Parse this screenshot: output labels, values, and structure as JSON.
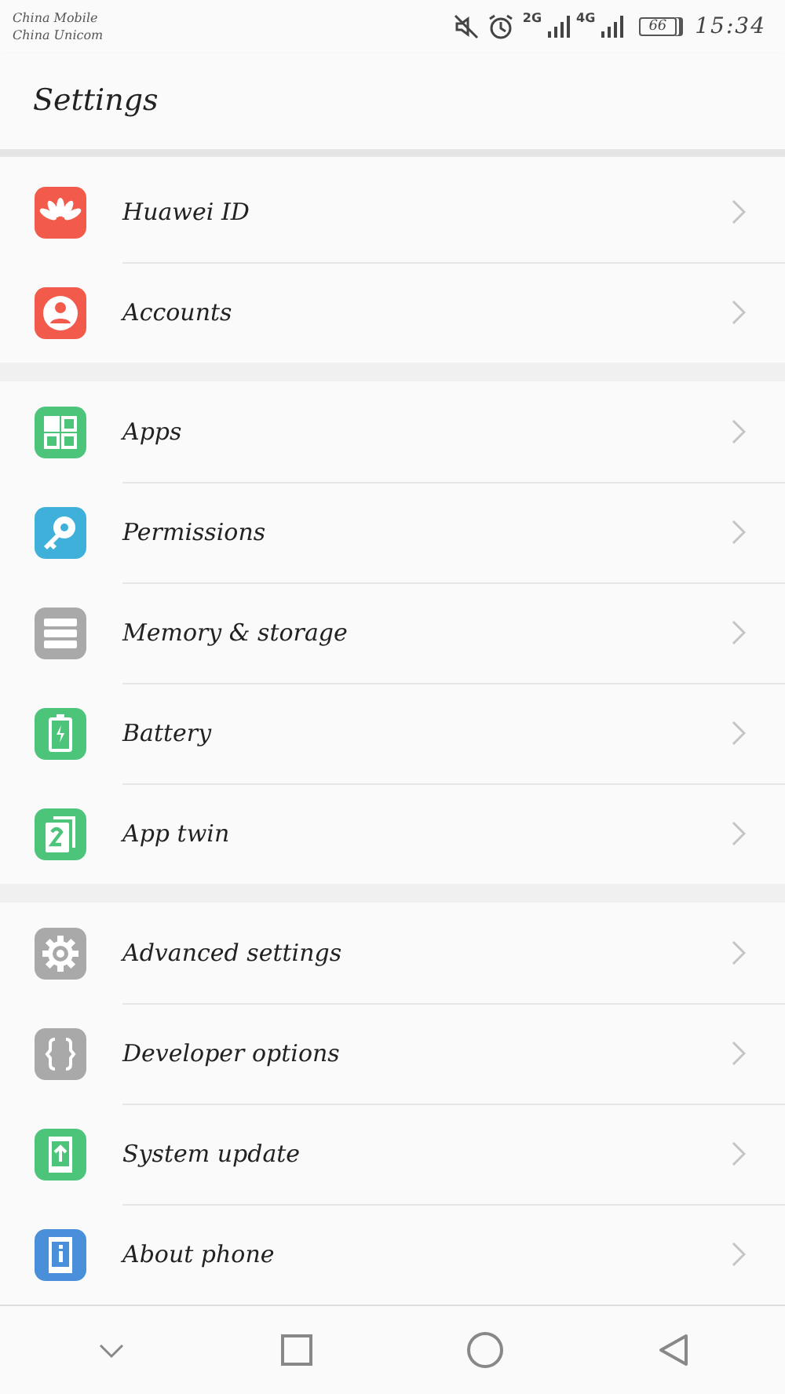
{
  "status_bar": {
    "carriers": [
      "China Mobile",
      "China Unicom"
    ],
    "network_1": "2G",
    "network_2": "4G",
    "battery": "66",
    "time": "15:34"
  },
  "header": {
    "title": "Settings"
  },
  "groups": [
    {
      "items": [
        {
          "label": "Huawei ID",
          "kind": "petals",
          "color": "#f25a4c"
        },
        {
          "label": "Accounts",
          "kind": "person",
          "color": "#f25a4c"
        }
      ]
    },
    {
      "items": [
        {
          "label": "Apps",
          "kind": "grid",
          "color": "#4cc47a"
        },
        {
          "label": "Permissions",
          "kind": "key",
          "color": "#3fb0d9"
        },
        {
          "label": "Memory & storage",
          "kind": "storage",
          "color": "#a9a9a9"
        },
        {
          "label": "Battery",
          "kind": "battery",
          "color": "#4cc47a"
        },
        {
          "label": "App twin",
          "kind": "twin",
          "color": "#4cc47a"
        }
      ]
    },
    {
      "items": [
        {
          "label": "Advanced settings",
          "kind": "gear",
          "color": "#a9a9a9"
        },
        {
          "label": "Developer options",
          "kind": "braces",
          "color": "#a9a9a9"
        },
        {
          "label": "System update",
          "kind": "update",
          "color": "#4cc47a"
        },
        {
          "label": "About phone",
          "kind": "info",
          "color": "#4a8fd9"
        }
      ]
    }
  ]
}
